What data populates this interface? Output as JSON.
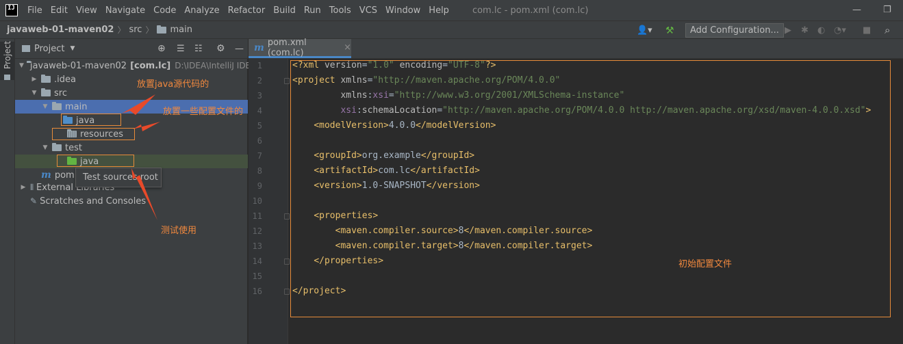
{
  "menubar": {
    "logo": "IJ",
    "items": [
      "File",
      "Edit",
      "View",
      "Navigate",
      "Code",
      "Analyze",
      "Refactor",
      "Build",
      "Run",
      "Tools",
      "VCS",
      "Window",
      "Help"
    ],
    "title": "com.lc - pom.xml (com.lc)",
    "minimize": "—",
    "restore": "❐"
  },
  "navbar": {
    "breadcrumb": [
      "javaweb-01-maven02",
      "src",
      "main"
    ],
    "add_configuration": "Add Configuration..."
  },
  "left_stripe": {
    "project_label": "Project"
  },
  "project_panel": {
    "title": "Project",
    "tree": [
      {
        "label": "javaweb-01-maven02",
        "module": "[com.lc]",
        "path": "D:\\IDEA\\IntelliJ IDEA"
      },
      {
        "label": ".idea"
      },
      {
        "label": "src"
      },
      {
        "label": "main"
      },
      {
        "label": "java"
      },
      {
        "label": "resources"
      },
      {
        "label": "test"
      },
      {
        "label": "java"
      },
      {
        "label": "pom."
      },
      {
        "label": "External Libraries"
      },
      {
        "label": "Scratches and Consoles"
      }
    ],
    "tooltip": "Test sources root",
    "annotations": {
      "java_source": "放置java源代码的",
      "config_files": "放置一些配置文件的",
      "test_use": "测试使用"
    }
  },
  "editor": {
    "tab_label": "pom.xml (com.lc)",
    "tab_close": "×",
    "annotation": "初始配置文件",
    "line_numbers": [
      "1",
      "2",
      "3",
      "4",
      "5",
      "6",
      "7",
      "8",
      "9",
      "10",
      "11",
      "12",
      "13",
      "14",
      "15",
      "16"
    ],
    "code": {
      "l1_decl": "<?xml",
      "l1_version_attr": "version",
      "l1_version_val": "\"1.0\"",
      "l1_encoding_attr": "encoding",
      "l1_encoding_val": "\"UTF-8\"",
      "l1_end": "?>",
      "l2_open": "<project",
      "l2_attr": "xmlns",
      "l2_val": "\"http://maven.apache.org/POM/4.0.0\"",
      "l3_prefix": "xmlns",
      "l3_ns": "xsi",
      "l3_val": "\"http://www.w3.org/2001/XMLSchema-instance\"",
      "l4_ns": "xsi",
      "l4_attr": "schemaLocation",
      "l4_val": "\"http://maven.apache.org/POM/4.0.0 http://maven.apache.org/xsd/maven-4.0.0.xsd\"",
      "l4_end": ">",
      "l5_open": "<modelVersion>",
      "l5_text": "4.0.0",
      "l5_close": "</modelVersion>",
      "l7_open": "<groupId>",
      "l7_text": "org.example",
      "l7_close": "</groupId>",
      "l8_open": "<artifactId>",
      "l8_text": "com.lc",
      "l8_close": "</artifactId>",
      "l9_open": "<version>",
      "l9_text": "1.0-SNAPSHOT",
      "l9_close": "</version>",
      "l11_open": "<properties>",
      "l12_open": "<maven.compiler.source>",
      "l12_text": "8",
      "l12_close": "</maven.compiler.source>",
      "l13_open": "<maven.compiler.target>",
      "l13_text": "8",
      "l13_close": "</maven.compiler.target>",
      "l14_close": "</properties>",
      "l16_close": "</project>"
    }
  },
  "colors": {
    "accent": "#4b6eaf",
    "annotation": "#e88c3a",
    "tag": "#e8bf6a",
    "string": "#6a8759",
    "namespace": "#9876aa"
  }
}
